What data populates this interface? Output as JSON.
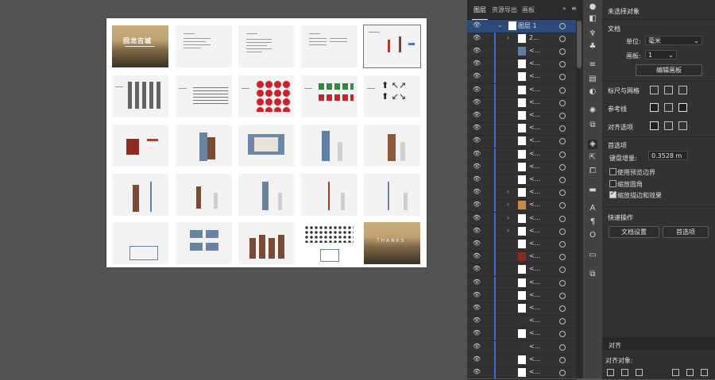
{
  "layers_panel": {
    "tabs": [
      "图层",
      "资源导出",
      "画板"
    ],
    "top_layer_name": "图层 1",
    "first_group_name": "2...",
    "item_name": "<...",
    "collapse_label": "»",
    "menu_label": "≡"
  },
  "properties": {
    "no_selection": "未选择对象",
    "document_title": "文档",
    "units_label": "单位:",
    "units_value": "毫米",
    "artboard_label": "画板:",
    "artboard_value": "1",
    "edit_artboards_button": "编辑画板",
    "rulers_grids_title": "标尺与网格",
    "guides_title": "参考线",
    "align_options_title": "对齐选项",
    "preferences_title": "首选项",
    "keyboard_increment_label": "键盘增量:",
    "keyboard_increment_value": "0.3528 m",
    "use_preview_bounds": "使用预览边界",
    "scale_corners": "缩放圆角",
    "scale_strokes_effects": "缩放描边和效果",
    "use_preview_bounds_checked": false,
    "scale_corners_checked": false,
    "scale_strokes_effects_checked": true,
    "quick_actions_title": "快速操作",
    "document_setup_button": "文档设置",
    "preferences_button": "首选项"
  },
  "align_panel": {
    "tab_label": "对齐",
    "align_to_label": "对齐对象:"
  },
  "artboard_cover": {
    "title": "回龙古城",
    "end_title": "THANKS"
  },
  "colors": {
    "accent_blue": "#3d6ad6",
    "panel_bg": "#323232",
    "canvas_bg": "#535353"
  }
}
